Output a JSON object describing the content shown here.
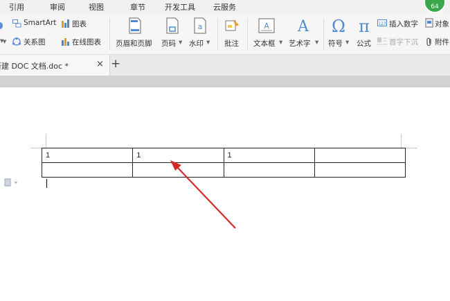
{
  "menu": {
    "items": [
      "引用",
      "审阅",
      "视图",
      "章节",
      "开发工具",
      "云服务"
    ],
    "badge": "64"
  },
  "ribbon": {
    "smartart": "SmartArt",
    "chart": "图表",
    "relation": "关系图",
    "online_chart": "在线图表",
    "header_footer": "页眉和页脚",
    "page_number": "页码",
    "watermark": "水印",
    "comment": "批注",
    "textbox": "文本框",
    "wordart": "艺术字",
    "symbol": "符号",
    "formula": "公式",
    "insert_number": "插入数字",
    "object": "对象",
    "drop_cap": "首字下沉",
    "attachment": "附件",
    "dropdown_arrow": "▾"
  },
  "tabs": {
    "doc_title": "新建 DOC 文档.doc *",
    "close": "×",
    "add": "+"
  },
  "table": {
    "rows": [
      [
        "1",
        "1",
        "1",
        ""
      ],
      [
        "",
        "",
        "",
        ""
      ]
    ]
  },
  "colors": {
    "arrow": "#d42a2a",
    "badge": "#3aa84a"
  }
}
